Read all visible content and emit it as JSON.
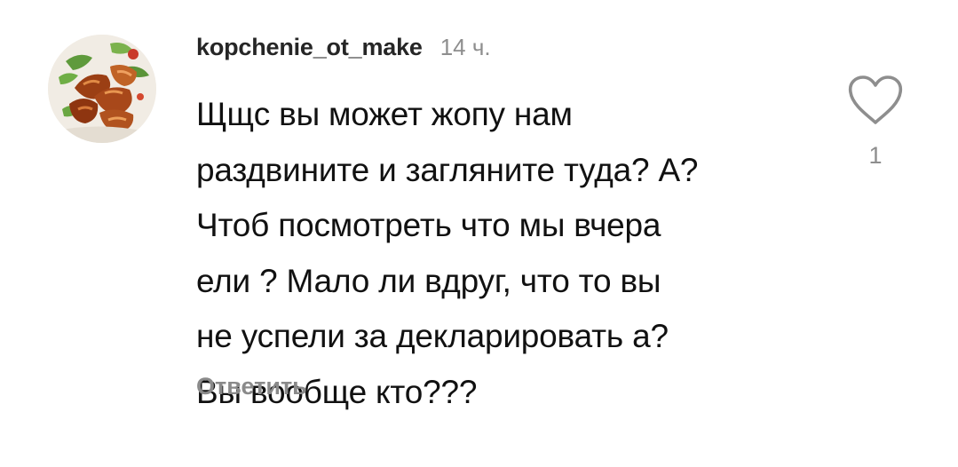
{
  "comment": {
    "username": "kopchenie_ot_make",
    "time": "14 ч.",
    "text": "Щщс вы может жопу нам\nраздвините и загляните туда? А?\nЧтоб посмотреть что мы вчера\nели ? Мало ли вдруг, что то вы\nне успели за декларировать а?\nВы вообще кто???",
    "reply_label": "Ответить",
    "like_count": "1"
  },
  "icons": {
    "avatar": "smoked-chicken-wings-avatar",
    "like": "heart-outline-icon"
  },
  "colors": {
    "text": "#111111",
    "username": "#262626",
    "secondary": "#8e8e8e",
    "background": "#ffffff"
  }
}
